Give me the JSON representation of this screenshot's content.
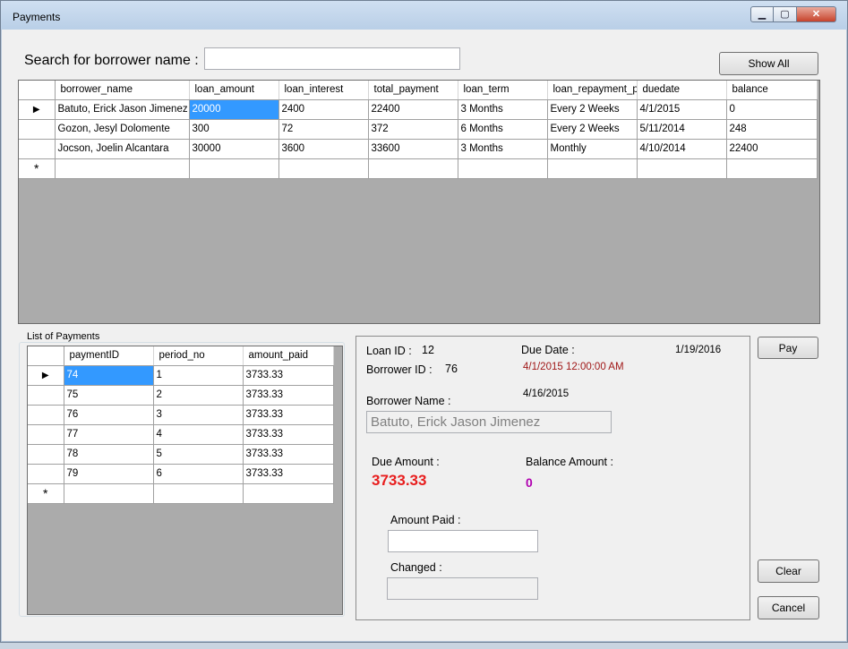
{
  "window": {
    "title": "Payments"
  },
  "search": {
    "label": "Search for borrower name :",
    "value": "",
    "show_all_label": "Show All"
  },
  "loans_grid": {
    "columns": [
      "borrower_name",
      "loan_amount",
      "loan_interest",
      "total_payment",
      "loan_term",
      "loan_repayment_p",
      "duedate",
      "balance"
    ],
    "rows": [
      [
        "Batuto, Erick Jason Jimenez",
        "20000",
        "2400",
        "22400",
        "3 Months",
        "Every 2 Weeks",
        "4/1/2015",
        "0"
      ],
      [
        "Gozon, Jesyl Dolomente",
        "300",
        "72",
        "372",
        "6 Months",
        "Every 2 Weeks",
        "5/11/2014",
        "248"
      ],
      [
        "Jocson, Joelin Alcantara",
        "30000",
        "3600",
        "33600",
        "3 Months",
        "Monthly",
        "4/10/2014",
        "22400"
      ]
    ]
  },
  "payments_group": {
    "label": "List of Payments",
    "columns": [
      "paymentID",
      "period_no",
      "amount_paid"
    ],
    "rows": [
      [
        "74",
        "1",
        "3733.33"
      ],
      [
        "75",
        "2",
        "3733.33"
      ],
      [
        "76",
        "3",
        "3733.33"
      ],
      [
        "77",
        "4",
        "3733.33"
      ],
      [
        "78",
        "5",
        "3733.33"
      ],
      [
        "79",
        "6",
        "3733.33"
      ]
    ]
  },
  "details": {
    "loan_id_label": "Loan ID :",
    "loan_id": "12",
    "borrower_id_label": "Borrower ID :",
    "borrower_id": "76",
    "due_date_label": "Due Date :",
    "due_date_value": "4/1/2015 12:00:00 AM",
    "current_date": "1/19/2016",
    "second_date": "4/16/2015",
    "borrower_name_label": "Borrower Name :",
    "borrower_name": "Batuto, Erick Jason Jimenez",
    "due_amount_label": "Due Amount :",
    "due_amount": "3733.33",
    "balance_amount_label": "Balance Amount :",
    "balance_amount": "0",
    "amount_paid_label": "Amount Paid :",
    "amount_paid": "",
    "changed_label": "Changed :",
    "changed": ""
  },
  "buttons": {
    "pay": "Pay",
    "clear": "Clear",
    "cancel": "Cancel"
  },
  "icons": {
    "row_indicator": "▶",
    "new_row": "*"
  },
  "colors": {
    "selection": "#3399ff",
    "due_amount": "#e81e1e",
    "balance_amount": "#b000b0",
    "due_date": "#a01818"
  }
}
